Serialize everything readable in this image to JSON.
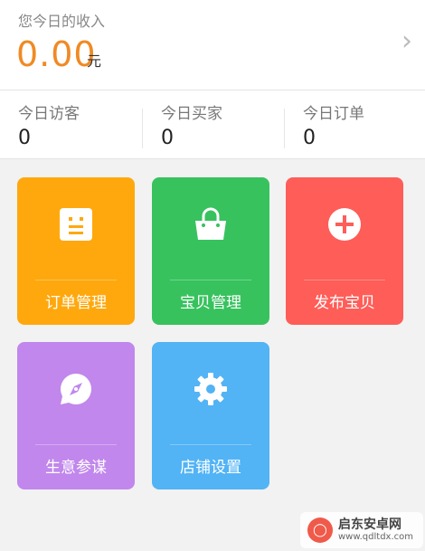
{
  "income": {
    "label": "您今日的收入",
    "amount": "0.00",
    "unit": "元",
    "arrow": "›"
  },
  "stats": [
    {
      "label": "今日访客",
      "value": "0"
    },
    {
      "label": "今日买家",
      "value": "0"
    },
    {
      "label": "今日订单",
      "value": "0"
    }
  ],
  "tiles": [
    {
      "label": "订单管理",
      "color": "#ffa80d",
      "icon": "order-list-icon"
    },
    {
      "label": "宝贝管理",
      "color": "#37c25e",
      "icon": "shopping-bag-icon"
    },
    {
      "label": "发布宝贝",
      "color": "#ff5d58",
      "icon": "plus-circle-icon"
    },
    {
      "label": "生意参谋",
      "color": "#c187ec",
      "icon": "compass-icon"
    },
    {
      "label": "店铺设置",
      "color": "#52b3f5",
      "icon": "gear-icon"
    }
  ],
  "watermark": {
    "title": "启东安卓网",
    "url": "www.qdltdx.com"
  }
}
